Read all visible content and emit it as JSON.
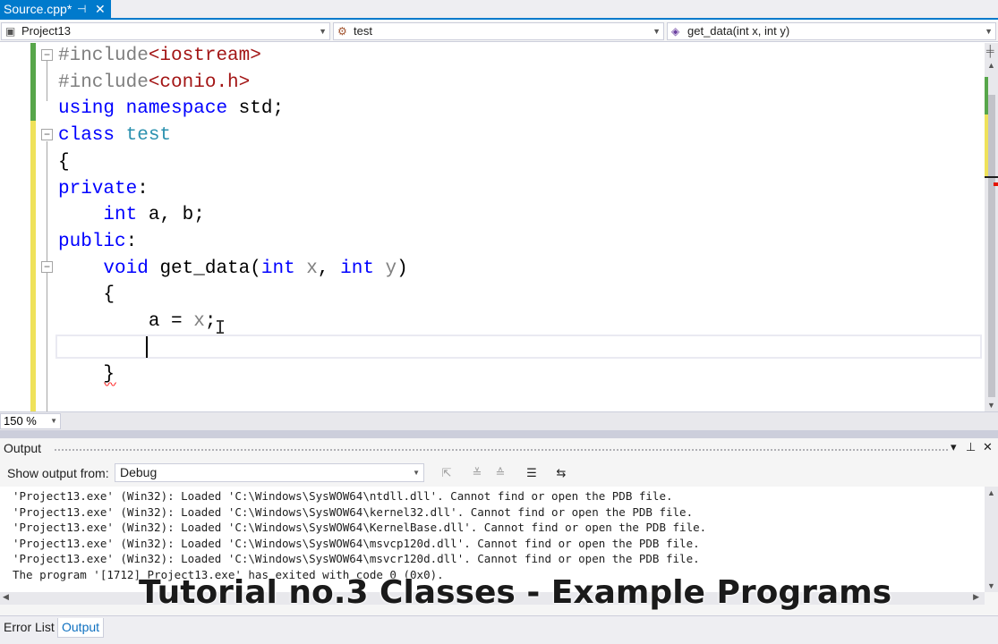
{
  "editor_tab": {
    "title": "Source.cpp*",
    "pin_icon": "pin-icon",
    "close_icon": "close-icon"
  },
  "nav": {
    "project": "Project13",
    "class": "test",
    "member": "get_data(int x, int y)"
  },
  "code": {
    "lines": [
      [
        {
          "t": "#include",
          "c": "pp"
        },
        {
          "t": "<iostream>",
          "c": "inc"
        }
      ],
      [
        {
          "t": "#include",
          "c": "pp"
        },
        {
          "t": "<conio.h>",
          "c": "inc"
        }
      ],
      [
        {
          "t": "using",
          "c": "kw"
        },
        {
          "t": " "
        },
        {
          "t": "namespace",
          "c": "kw"
        },
        {
          "t": " std;"
        }
      ],
      [
        {
          "t": "class",
          "c": "kw"
        },
        {
          "t": " "
        },
        {
          "t": "test",
          "c": "ty"
        }
      ],
      [
        {
          "t": "{"
        }
      ],
      [
        {
          "t": "private",
          "c": "kw"
        },
        {
          "t": ":"
        }
      ],
      [
        {
          "t": "    "
        },
        {
          "t": "int",
          "c": "kw"
        },
        {
          "t": " a, b;"
        }
      ],
      [
        {
          "t": "public",
          "c": "kw"
        },
        {
          "t": ":"
        }
      ],
      [
        {
          "t": "    "
        },
        {
          "t": "void",
          "c": "kw"
        },
        {
          "t": " get_data("
        },
        {
          "t": "int",
          "c": "kw"
        },
        {
          "t": " "
        },
        {
          "t": "x",
          "c": "par"
        },
        {
          "t": ", "
        },
        {
          "t": "int",
          "c": "kw"
        },
        {
          "t": " "
        },
        {
          "t": "y",
          "c": "par"
        },
        {
          "t": ")"
        }
      ],
      [
        {
          "t": "    {"
        }
      ],
      [
        {
          "t": "        a = "
        },
        {
          "t": "x",
          "c": "par"
        },
        {
          "t": ";"
        }
      ],
      [
        {
          "t": ""
        }
      ],
      [
        {
          "t": "    }"
        }
      ]
    ]
  },
  "zoom": "150 %",
  "output": {
    "title": "Output",
    "show_from_label": "Show output from:",
    "source": "Debug",
    "lines": [
      "'Project13.exe' (Win32): Loaded 'C:\\Windows\\SysWOW64\\ntdll.dll'. Cannot find or open the PDB file.",
      "'Project13.exe' (Win32): Loaded 'C:\\Windows\\SysWOW64\\kernel32.dll'. Cannot find or open the PDB file.",
      "'Project13.exe' (Win32): Loaded 'C:\\Windows\\SysWOW64\\KernelBase.dll'. Cannot find or open the PDB file.",
      "'Project13.exe' (Win32): Loaded 'C:\\Windows\\SysWOW64\\msvcp120d.dll'. Cannot find or open the PDB file.",
      "'Project13.exe' (Win32): Loaded 'C:\\Windows\\SysWOW64\\msvcr120d.dll'. Cannot find or open the PDB file.",
      "The program '[1712] Project13.exe' has exited with code 0 (0x0)."
    ]
  },
  "caption": "Tutorial no.3 Classes - Example Programs",
  "bottom_tabs": [
    "Error List",
    "Output"
  ],
  "colors": {
    "accent": "#007acc",
    "keyword": "#0000ff",
    "type": "#2b91af",
    "include": "#a31515"
  }
}
